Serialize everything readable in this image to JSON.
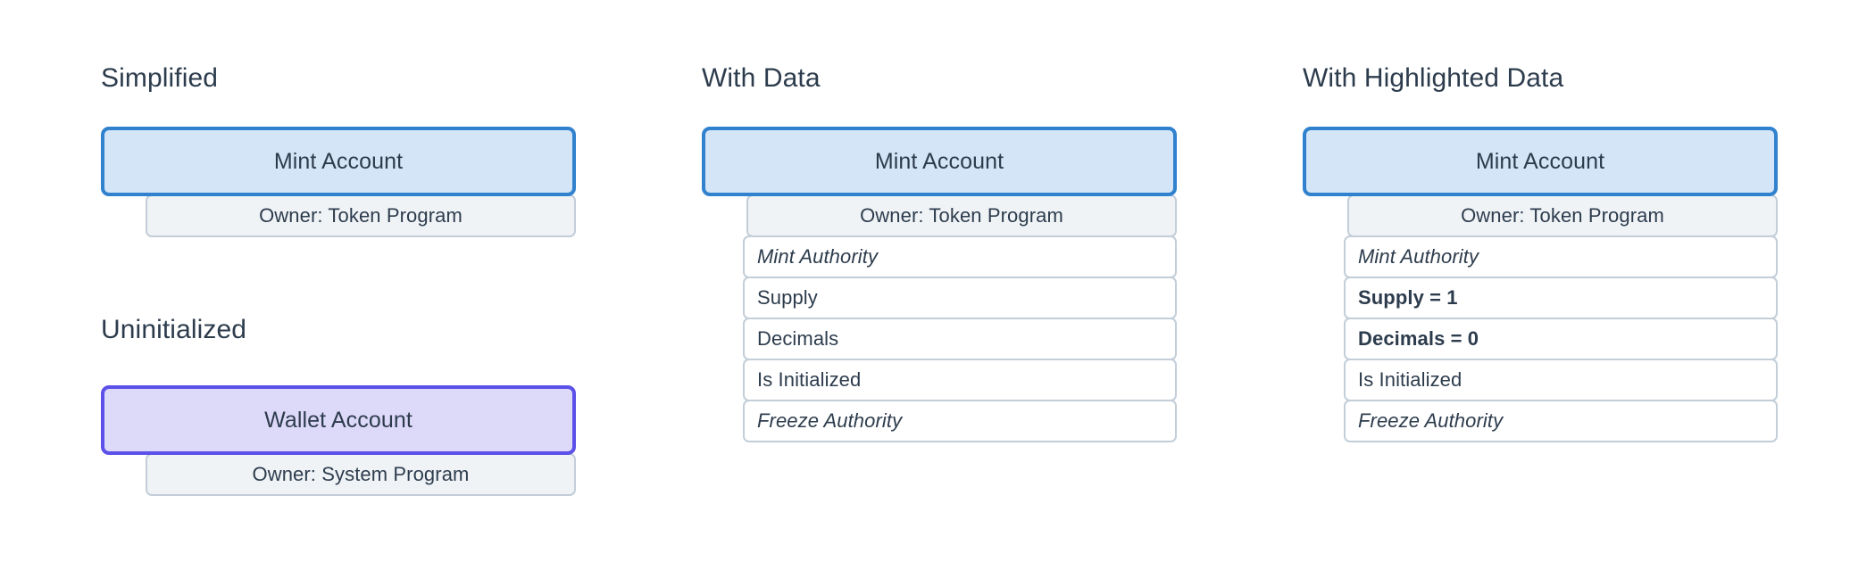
{
  "diagram": {
    "background": "#ffffff",
    "colors": {
      "title_text": "#2d3c4d",
      "mint_border": "#3182ce",
      "mint_fill": "#d4e5f7",
      "wallet_border": "#5b51e8",
      "wallet_fill": "#ddd9f9",
      "row_border": "#c3ced8",
      "owner_fill": "#eff3f6",
      "field_fill": "#ffffff",
      "row_text": "#2d3c4d"
    },
    "columns": [
      {
        "id": "simplified",
        "title": "Simplified",
        "groups": [
          {
            "id": "mint-account-simple",
            "header": "Mint Account",
            "header_style": "blue",
            "rows": [
              {
                "label": "Owner: Token Program",
                "type": "owner",
                "style": "normal"
              }
            ]
          },
          {
            "id": "wallet-account-uninitialized",
            "subtitle": "Uninitialized",
            "header": "Wallet Account",
            "header_style": "purple",
            "rows": [
              {
                "label": "Owner: System Program",
                "type": "owner",
                "style": "normal"
              }
            ]
          }
        ]
      },
      {
        "id": "with-data",
        "title": "With Data",
        "groups": [
          {
            "id": "mint-account-with-data",
            "header": "Mint Account",
            "header_style": "blue",
            "rows": [
              {
                "label": "Owner: Token Program",
                "type": "owner",
                "style": "normal"
              },
              {
                "label": "Mint Authority",
                "type": "field",
                "style": "italic"
              },
              {
                "label": "Supply",
                "type": "field",
                "style": "normal"
              },
              {
                "label": "Decimals",
                "type": "field",
                "style": "normal"
              },
              {
                "label": "Is Initialized",
                "type": "field",
                "style": "normal"
              },
              {
                "label": "Freeze Authority",
                "type": "field",
                "style": "italic"
              }
            ]
          }
        ]
      },
      {
        "id": "with-highlighted-data",
        "title": "With Highlighted Data",
        "groups": [
          {
            "id": "mint-account-highlighted",
            "header": "Mint Account",
            "header_style": "blue",
            "rows": [
              {
                "label": "Owner: Token Program",
                "type": "owner",
                "style": "normal"
              },
              {
                "label": "Mint Authority",
                "type": "field",
                "style": "italic"
              },
              {
                "label": "Supply = 1",
                "type": "field",
                "style": "bold"
              },
              {
                "label": "Decimals = 0",
                "type": "field",
                "style": "bold"
              },
              {
                "label": "Is Initialized",
                "type": "field",
                "style": "normal"
              },
              {
                "label": "Freeze Authority",
                "type": "field",
                "style": "italic"
              }
            ]
          }
        ]
      }
    ]
  }
}
